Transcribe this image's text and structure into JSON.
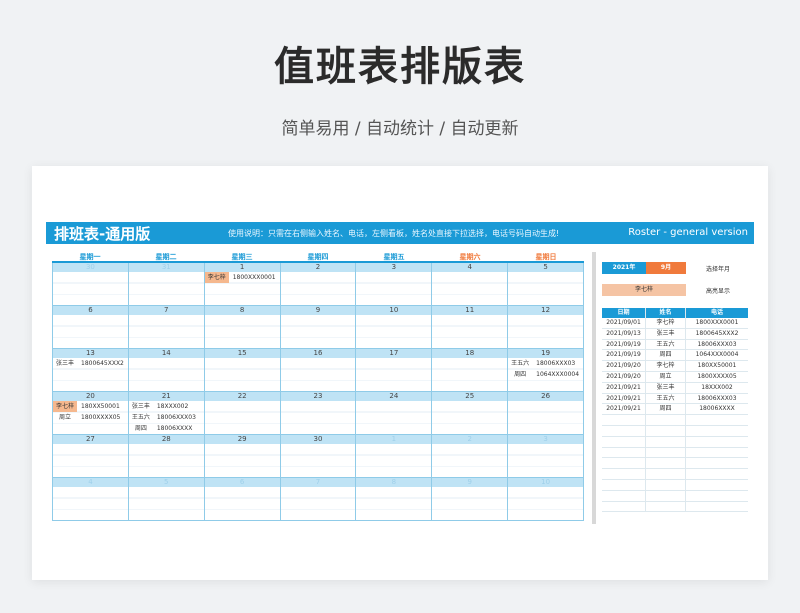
{
  "hero": {
    "title": "值班表排版表",
    "subtitle": "简单易用  /  自动统计  /  自动更新"
  },
  "banner": {
    "title": "排班表-通用版",
    "description": "使用说明：只需在右侧输入姓名、电话，左侧看板，姓名处直接下拉选择，电话号码自动生成!",
    "english": "Roster - general version"
  },
  "calendar": {
    "weekdays": [
      "星期一",
      "星期二",
      "星期三",
      "星期四",
      "星期五",
      "星期六",
      "星期日"
    ],
    "weeks": [
      {
        "dates": [
          "30",
          "31",
          "1",
          "2",
          "3",
          "4",
          "5"
        ],
        "dim": [
          true,
          true,
          false,
          false,
          false,
          false,
          false
        ],
        "cells": [
          [],
          [],
          [
            {
              "name": "李七梓",
              "phone": "1800XXX0001",
              "hl": true
            }
          ],
          [],
          [],
          [],
          []
        ]
      },
      {
        "dates": [
          "6",
          "7",
          "8",
          "9",
          "10",
          "11",
          "12"
        ],
        "dim": [
          false,
          false,
          false,
          false,
          false,
          false,
          false
        ],
        "cells": [
          [],
          [],
          [],
          [],
          [],
          [],
          []
        ]
      },
      {
        "dates": [
          "13",
          "14",
          "15",
          "16",
          "17",
          "18",
          "19"
        ],
        "dim": [
          false,
          false,
          false,
          false,
          false,
          false,
          false
        ],
        "cells": [
          [
            {
              "name": "张三丰",
              "phone": "1800645XXX2",
              "hl": false
            }
          ],
          [],
          [],
          [],
          [],
          [],
          [
            {
              "name": "王五六",
              "phone": "18006XXX03",
              "hl": false
            },
            {
              "name": "周四",
              "phone": "1064XXX0004",
              "hl": false
            }
          ]
        ]
      },
      {
        "dates": [
          "20",
          "21",
          "22",
          "23",
          "24",
          "25",
          "26"
        ],
        "dim": [
          false,
          false,
          false,
          false,
          false,
          false,
          false
        ],
        "cells": [
          [
            {
              "name": "李七梓",
              "phone": "180XX50001",
              "hl": true
            },
            {
              "name": "周立",
              "phone": "1800XXXX05",
              "hl": false
            }
          ],
          [
            {
              "name": "张三丰",
              "phone": "18XXX002",
              "hl": false
            },
            {
              "name": "王五六",
              "phone": "18006XXX03",
              "hl": false
            },
            {
              "name": "周四",
              "phone": "18006XXXX",
              "hl": false
            }
          ],
          [],
          [],
          [],
          [],
          []
        ]
      },
      {
        "dates": [
          "27",
          "28",
          "29",
          "30",
          "1",
          "2",
          "3"
        ],
        "dim": [
          false,
          false,
          false,
          false,
          true,
          true,
          true
        ],
        "cells": [
          [],
          [],
          [],
          [],
          [],
          [],
          []
        ]
      },
      {
        "dates": [
          "4",
          "5",
          "6",
          "7",
          "8",
          "9",
          "10"
        ],
        "dim": [
          true,
          true,
          true,
          true,
          true,
          true,
          true
        ],
        "cells": [
          [],
          [],
          [],
          [],
          [],
          [],
          []
        ]
      }
    ]
  },
  "panel": {
    "year": "2021年",
    "month": "9月",
    "select_label": "选择年月",
    "highlight_name": "李七梓",
    "highlight_label": "高亮显示",
    "table_headers": [
      "日期",
      "姓名",
      "电话"
    ],
    "rows": [
      [
        "2021/09/01",
        "李七梓",
        "1800XXX0001"
      ],
      [
        "2021/09/13",
        "张三丰",
        "1800645XXX2"
      ],
      [
        "2021/09/19",
        "王五六",
        "18006XXX03"
      ],
      [
        "2021/09/19",
        "周四",
        "1064XXX0004"
      ],
      [
        "2021/09/20",
        "李七梓",
        "180XX50001"
      ],
      [
        "2021/09/20",
        "周立",
        "1800XXXX05"
      ],
      [
        "2021/09/21",
        "张三丰",
        "18XXX002"
      ],
      [
        "2021/09/21",
        "王五六",
        "18006XXX03"
      ],
      [
        "2021/09/21",
        "周四",
        "18006XXXX"
      ],
      [
        "",
        "",
        ""
      ],
      [
        "",
        "",
        ""
      ],
      [
        "",
        "",
        ""
      ],
      [
        "",
        "",
        ""
      ],
      [
        "",
        "",
        ""
      ],
      [
        "",
        "",
        ""
      ],
      [
        "",
        "",
        ""
      ],
      [
        "",
        "",
        ""
      ],
      [
        "",
        "",
        ""
      ]
    ]
  },
  "colors": {
    "accent": "#1a9ad6",
    "orange": "#f07a3c",
    "highlight": "#f5b88e"
  }
}
